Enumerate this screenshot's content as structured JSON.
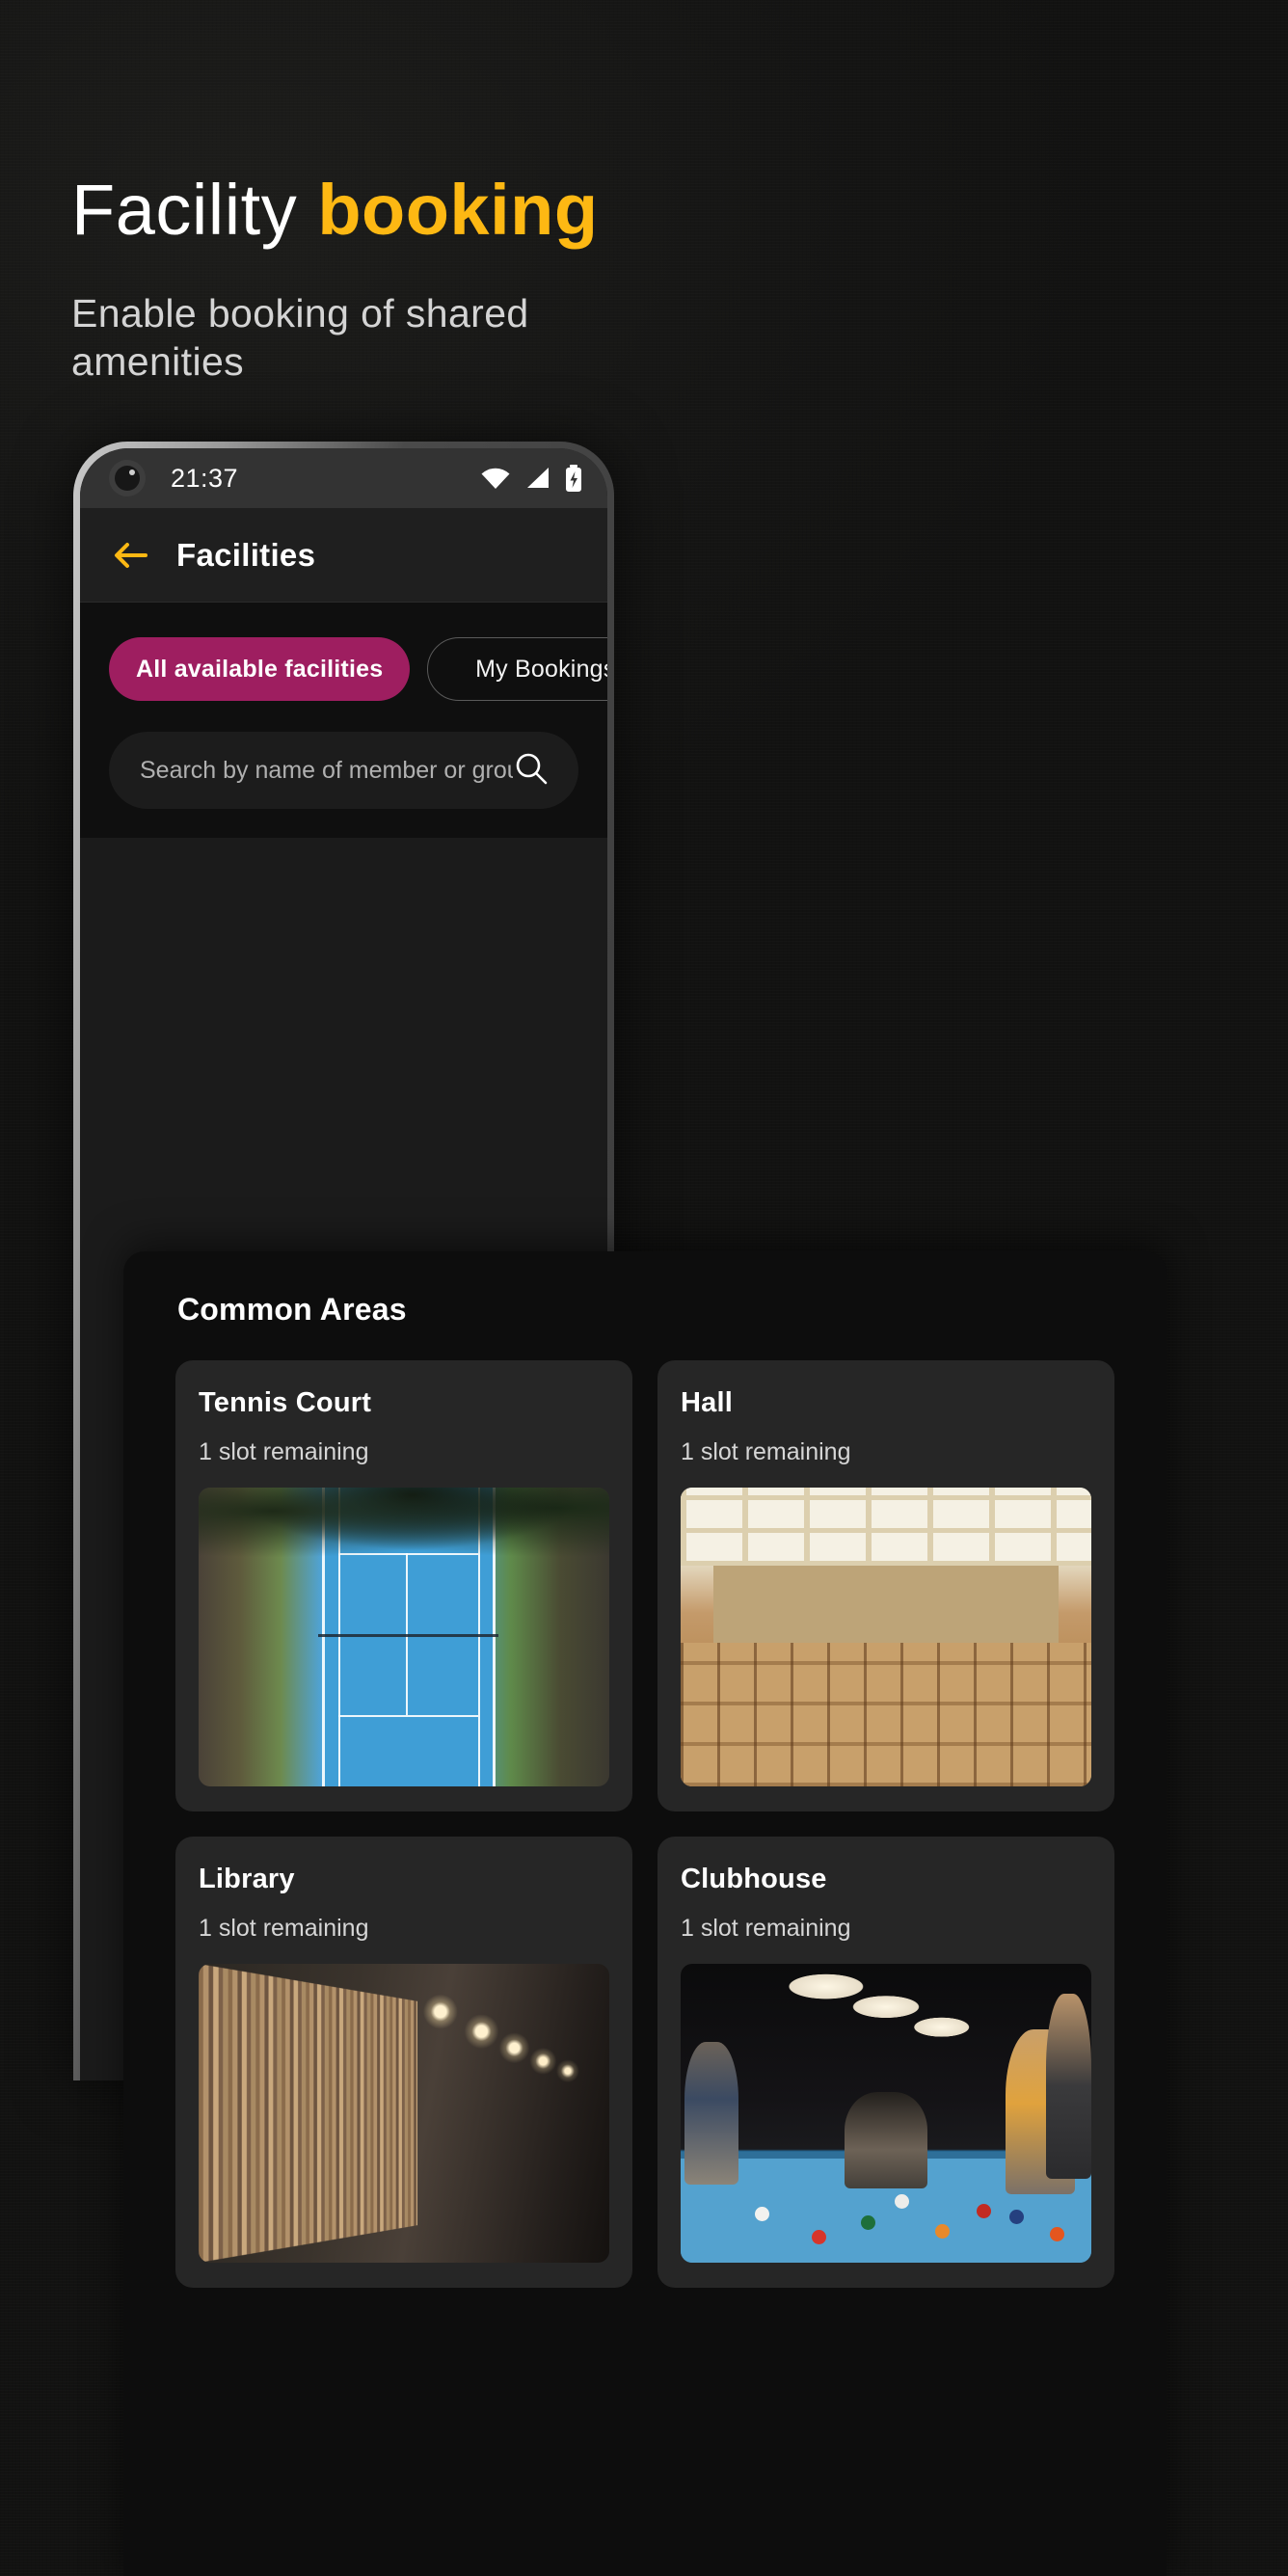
{
  "hero": {
    "title_plain": "Facility ",
    "title_accent": "booking",
    "subtitle": "Enable booking of shared amenities",
    "accent_color": "#FDB813"
  },
  "phone": {
    "status_bar": {
      "time": "21:37",
      "icons": [
        "wifi-icon",
        "cellular-signal-icon",
        "battery-charging-icon"
      ]
    },
    "app_bar": {
      "back_icon": "back-arrow-icon",
      "title": "Facilities"
    },
    "tabs": [
      {
        "label": "All available facilities",
        "active": true
      },
      {
        "label": "My Bookings",
        "active": false
      }
    ],
    "search": {
      "placeholder": "Search by name of member or group",
      "value": "",
      "icon": "search-icon"
    }
  },
  "content": {
    "section_title": "Common Areas",
    "cards": [
      {
        "title": "Tennis Court",
        "subtitle": "1 slot remaining",
        "image": "tennis-court-aerial-photo"
      },
      {
        "title": "Hall",
        "subtitle": "1 slot remaining",
        "image": "auditorium-hall-photo"
      },
      {
        "title": "Library",
        "subtitle": "1 slot remaining",
        "image": "library-bookshelves-photo"
      },
      {
        "title": "Clubhouse",
        "subtitle": "1 slot remaining",
        "image": "billiards-clubhouse-photo"
      }
    ]
  },
  "colors": {
    "accent": "#FDB813",
    "tab_active_bg": "#9E1E60",
    "page_bg": "#141413",
    "card_bg": "#262626",
    "panel_bg": "#0D0D0D"
  }
}
